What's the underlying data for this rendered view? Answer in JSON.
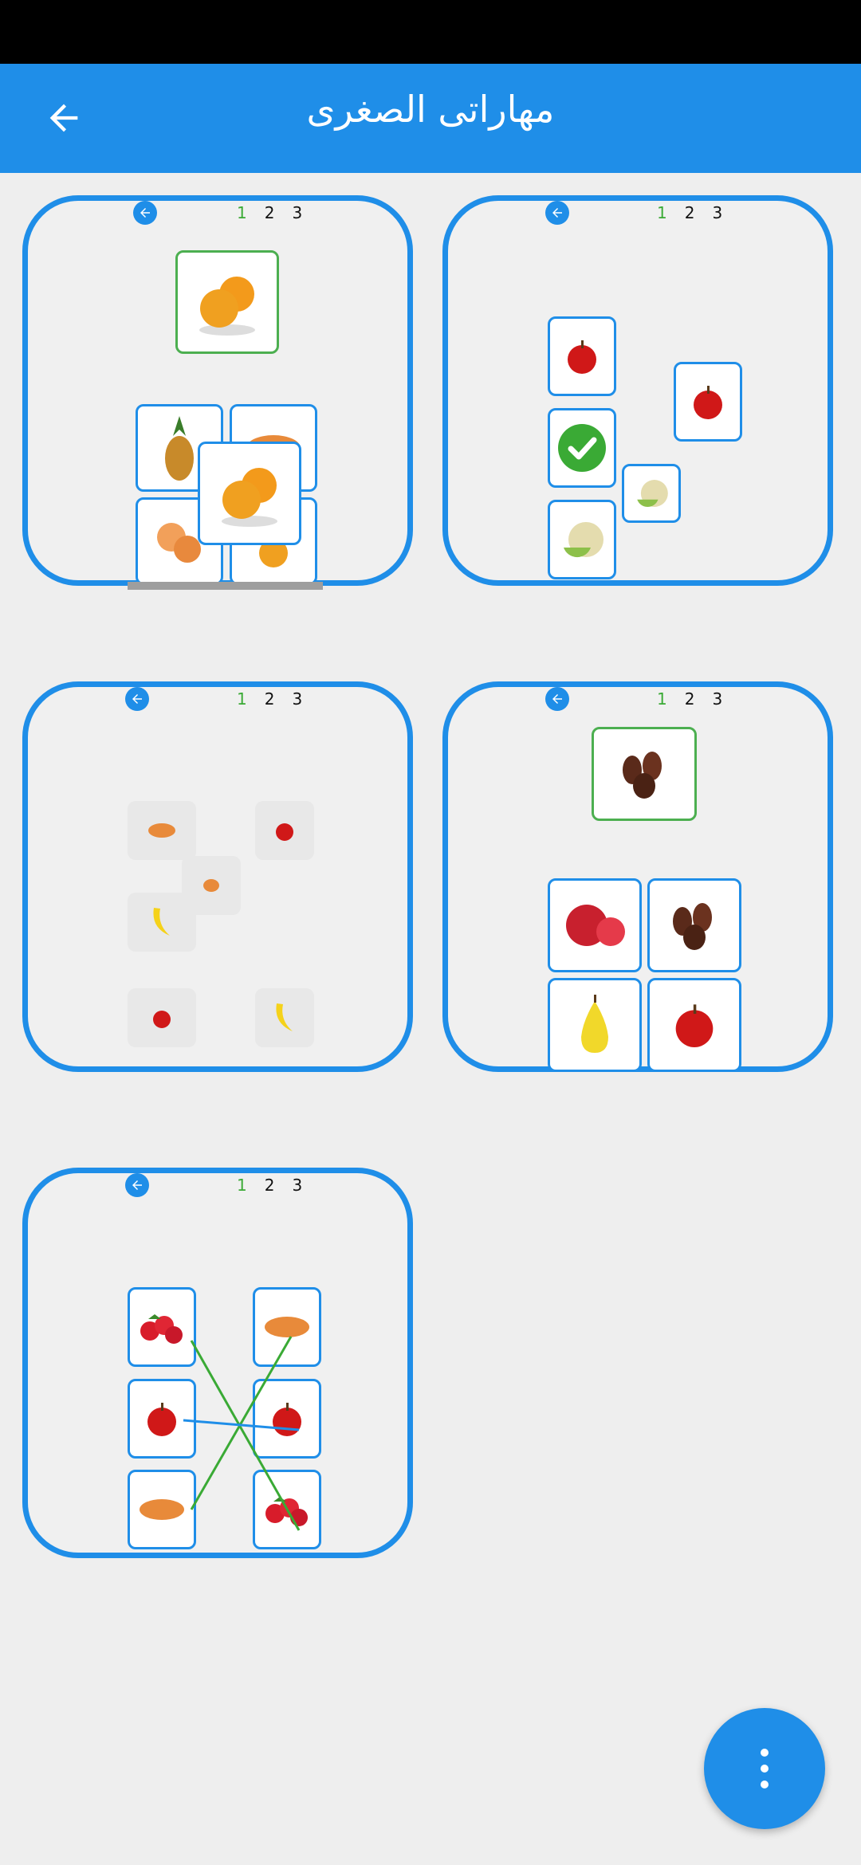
{
  "app": {
    "title": "مهاراتی الصغری"
  },
  "cards": [
    {
      "name": "sort-oranges",
      "pages": [
        "1",
        "2",
        "3"
      ]
    },
    {
      "name": "apple-match",
      "pages": [
        "1",
        "2",
        "3"
      ]
    },
    {
      "name": "memory-fruits",
      "pages": [
        "1",
        "2",
        "3"
      ]
    },
    {
      "name": "dates-choice",
      "pages": [
        "1",
        "2",
        "3"
      ]
    },
    {
      "name": "line-matching",
      "pages": [
        "1",
        "2",
        "3"
      ]
    }
  ],
  "icons": {
    "back": "arrow-left-icon",
    "fab": "more-vertical-icon"
  },
  "colors": {
    "primary": "#1f8ee8",
    "correct": "#4caf50",
    "active_page": "#3aaa35"
  }
}
